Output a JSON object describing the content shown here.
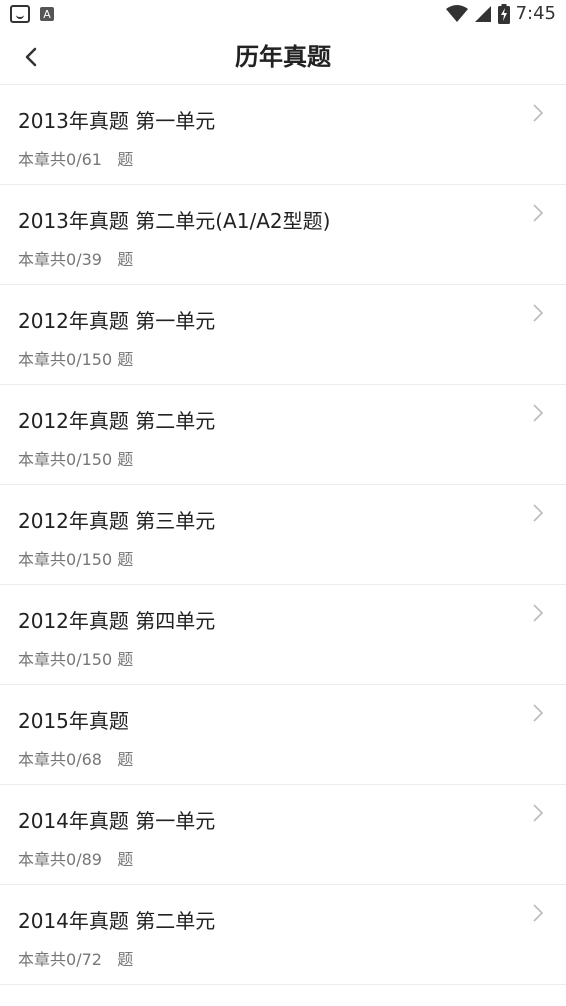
{
  "status_bar": {
    "time": "7:45",
    "notification_icon_text": "A"
  },
  "header": {
    "title": "历年真题"
  },
  "items": [
    {
      "title": "2013年真题 第一单元",
      "count_prefix": "本章共",
      "count": "0/61",
      "suffix": "题"
    },
    {
      "title": "2013年真题 第二单元(A1/A2型题)",
      "count_prefix": "本章共",
      "count": "0/39",
      "suffix": "题"
    },
    {
      "title": "2012年真题 第一单元",
      "count_prefix": "本章共",
      "count": "0/150",
      "suffix": "题"
    },
    {
      "title": "2012年真题 第二单元",
      "count_prefix": "本章共",
      "count": "0/150",
      "suffix": "题"
    },
    {
      "title": "2012年真题 第三单元",
      "count_prefix": "本章共",
      "count": "0/150",
      "suffix": "题"
    },
    {
      "title": "2012年真题 第四单元",
      "count_prefix": "本章共",
      "count": "0/150",
      "suffix": "题"
    },
    {
      "title": "2015年真题",
      "count_prefix": "本章共",
      "count": "0/68",
      "suffix": "题"
    },
    {
      "title": "2014年真题 第一单元",
      "count_prefix": "本章共",
      "count": "0/89",
      "suffix": "题"
    },
    {
      "title": "2014年真题 第二单元",
      "count_prefix": "本章共",
      "count": "0/72",
      "suffix": "题"
    }
  ]
}
